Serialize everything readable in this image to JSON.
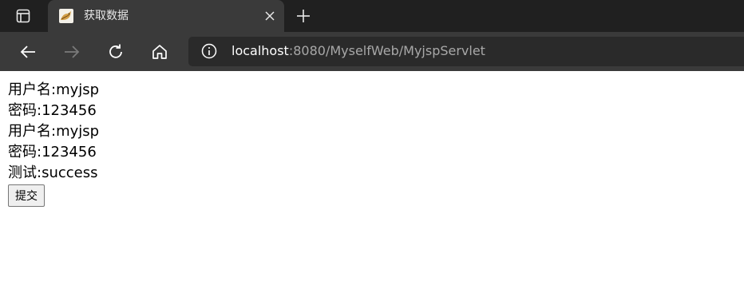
{
  "browser": {
    "tab": {
      "title": "获取数据",
      "favicon": "tomcat-icon"
    },
    "toolbar": {
      "back": "back-arrow-icon",
      "forward": "forward-arrow-icon",
      "refresh": "refresh-icon",
      "home": "home-icon"
    },
    "address": {
      "host": "localhost",
      "rest": ":8080/MyselfWeb/MyjspServlet",
      "info_icon": "info-icon"
    },
    "colors": {
      "tabbar_bg": "#202020",
      "toolbar_bg": "#3a3a3a",
      "address_bg": "#2a2a2a"
    }
  },
  "page": {
    "lines": [
      "用户名:myjsp",
      "密码:123456",
      "用户名:myjsp",
      "密码:123456",
      "测试:success"
    ],
    "submit_label": "提交"
  }
}
